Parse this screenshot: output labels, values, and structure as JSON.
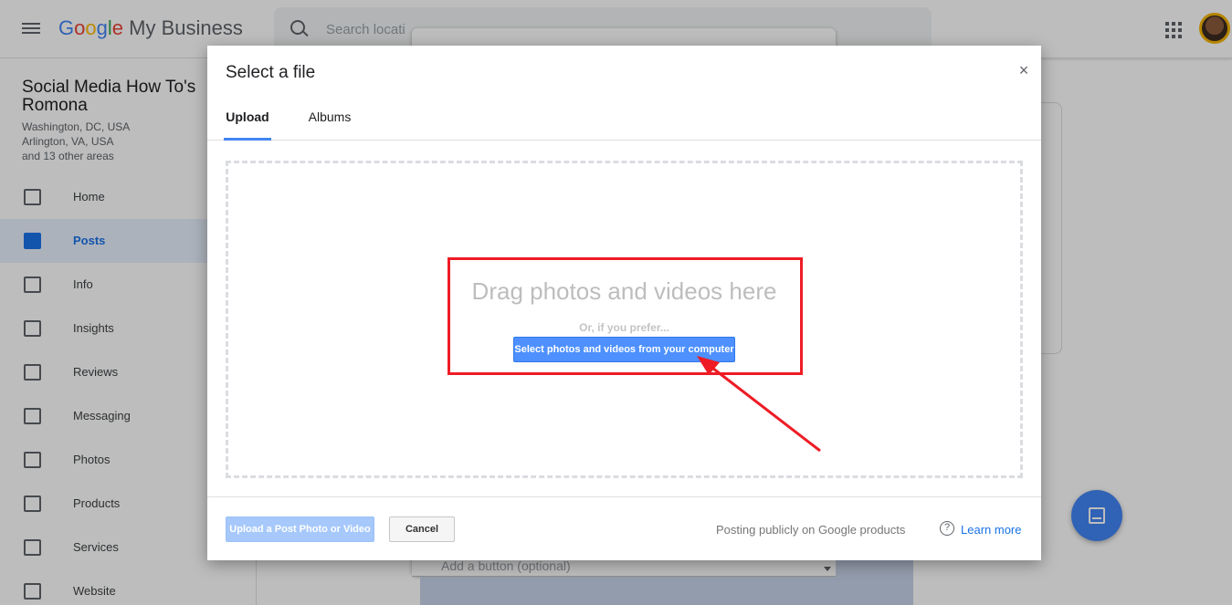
{
  "app": {
    "logo": {
      "google": [
        "G",
        "o",
        "o",
        "g",
        "l",
        "e"
      ],
      "product": "My Business"
    },
    "search_placeholder": "Search locati",
    "business": {
      "name": "Social Media How To's Romona",
      "lines": [
        "Washington, DC, USA",
        "Arlington, VA, USA",
        "and 13 other areas"
      ]
    },
    "nav": [
      {
        "label": "Home",
        "icon": "dashboard-icon",
        "active": false
      },
      {
        "label": "Posts",
        "icon": "posts-icon",
        "active": true
      },
      {
        "label": "Info",
        "icon": "storefront-icon",
        "active": false
      },
      {
        "label": "Insights",
        "icon": "bar-chart-icon",
        "active": false
      },
      {
        "label": "Reviews",
        "icon": "reviews-icon",
        "active": false
      },
      {
        "label": "Messaging",
        "icon": "message-icon",
        "active": false
      },
      {
        "label": "Photos",
        "icon": "photos-icon",
        "active": false
      },
      {
        "label": "Products",
        "icon": "basket-icon",
        "active": false
      },
      {
        "label": "Services",
        "icon": "list-icon",
        "active": false
      },
      {
        "label": "Website",
        "icon": "web-icon",
        "active": false
      }
    ],
    "post_form": {
      "button_select_label": "Add a button (optional)"
    }
  },
  "dialog": {
    "title": "Select a file",
    "close_glyph": "×",
    "tabs": [
      {
        "label": "Upload",
        "active": true
      },
      {
        "label": "Albums",
        "active": false
      }
    ],
    "dropzone": {
      "title": "Drag photos and videos here",
      "subtitle": "Or, if you prefer...",
      "select_button": "Select photos and videos from your computer"
    },
    "footer": {
      "upload_button": "Upload a Post Photo or Video",
      "cancel_button": "Cancel",
      "note": "Posting publicly on Google products",
      "help_glyph": "?",
      "learn_more": "Learn more"
    }
  },
  "colors": {
    "accent": "#4285F4",
    "annotation_red": "#ee1c25",
    "primary_button": "#4d90fe",
    "disabled_button": "#a6c8fb"
  }
}
